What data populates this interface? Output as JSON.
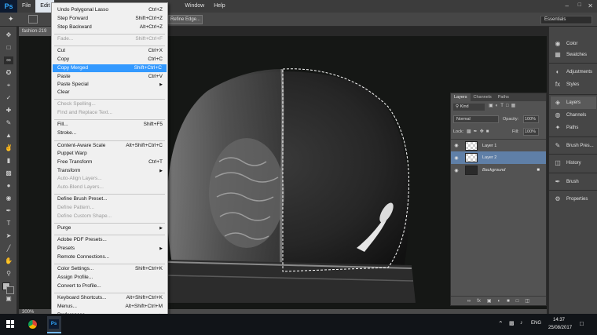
{
  "app": {
    "logo": "Ps"
  },
  "menubar": {
    "items": [
      "File",
      "Edit",
      "Window",
      "Help"
    ]
  },
  "options": {
    "refine_edge": "Refine Edge...",
    "workspace": "Essentials"
  },
  "document": {
    "tab": "fashion-219",
    "zoom": "300%"
  },
  "edit_menu": {
    "items": [
      {
        "label": "Undo Polygonal Lasso",
        "shortcut": "Ctrl+Z",
        "state": "normal"
      },
      {
        "label": "Step Forward",
        "shortcut": "Shift+Ctrl+Z",
        "state": "normal"
      },
      {
        "label": "Step Backward",
        "shortcut": "Alt+Ctrl+Z",
        "state": "normal"
      },
      {
        "label": "Fade...",
        "shortcut": "Shift+Ctrl+F",
        "state": "disabled"
      },
      {
        "label": "Cut",
        "shortcut": "Ctrl+X",
        "state": "normal"
      },
      {
        "label": "Copy",
        "shortcut": "Ctrl+C",
        "state": "normal"
      },
      {
        "label": "Copy Merged",
        "shortcut": "Shift+Ctrl+C",
        "state": "highlight"
      },
      {
        "label": "Paste",
        "shortcut": "Ctrl+V",
        "state": "normal"
      },
      {
        "label": "Paste Special",
        "shortcut": "",
        "state": "submenu"
      },
      {
        "label": "Clear",
        "shortcut": "",
        "state": "normal"
      },
      {
        "label": "Check Spelling...",
        "shortcut": "",
        "state": "disabled"
      },
      {
        "label": "Find and Replace Text...",
        "shortcut": "",
        "state": "disabled"
      },
      {
        "label": "Fill...",
        "shortcut": "Shift+F5",
        "state": "normal"
      },
      {
        "label": "Stroke...",
        "shortcut": "",
        "state": "normal"
      },
      {
        "label": "Content-Aware Scale",
        "shortcut": "Alt+Shift+Ctrl+C",
        "state": "normal"
      },
      {
        "label": "Puppet Warp",
        "shortcut": "",
        "state": "normal"
      },
      {
        "label": "Free Transform",
        "shortcut": "Ctrl+T",
        "state": "normal"
      },
      {
        "label": "Transform",
        "shortcut": "",
        "state": "submenu"
      },
      {
        "label": "Auto-Align Layers...",
        "shortcut": "",
        "state": "disabled"
      },
      {
        "label": "Auto-Blend Layers...",
        "shortcut": "",
        "state": "disabled"
      },
      {
        "label": "Define Brush Preset...",
        "shortcut": "",
        "state": "normal"
      },
      {
        "label": "Define Pattern...",
        "shortcut": "",
        "state": "disabled"
      },
      {
        "label": "Define Custom Shape...",
        "shortcut": "",
        "state": "disabled"
      },
      {
        "label": "Purge",
        "shortcut": "",
        "state": "submenu"
      },
      {
        "label": "Adobe PDF Presets...",
        "shortcut": "",
        "state": "normal"
      },
      {
        "label": "Presets",
        "shortcut": "",
        "state": "submenu"
      },
      {
        "label": "Remote Connections...",
        "shortcut": "",
        "state": "normal"
      },
      {
        "label": "Color Settings...",
        "shortcut": "Shift+Ctrl+K",
        "state": "normal"
      },
      {
        "label": "Assign Profile...",
        "shortcut": "",
        "state": "normal"
      },
      {
        "label": "Convert to Profile...",
        "shortcut": "",
        "state": "normal"
      },
      {
        "label": "Keyboard Shortcuts...",
        "shortcut": "Alt+Shift+Ctrl+K",
        "state": "normal"
      },
      {
        "label": "Menus...",
        "shortcut": "Alt+Shift+Ctrl+M",
        "state": "normal"
      },
      {
        "label": "Preferences",
        "shortcut": "",
        "state": "submenu"
      }
    ]
  },
  "dock": {
    "items": [
      "Color",
      "Swatches",
      "Adjustments",
      "Styles",
      "Layers",
      "Channels",
      "Paths",
      "Brush Pres...",
      "History",
      "Brush",
      "Properties"
    ]
  },
  "layers_panel": {
    "tabs": [
      "Layers",
      "Channels",
      "Paths"
    ],
    "filter": "Kind",
    "blend_mode": "Normal",
    "opacity_label": "Opacity:",
    "opacity": "100%",
    "lock_label": "Lock:",
    "fill_label": "Fill:",
    "fill": "100%",
    "layers": [
      {
        "name": "Layer 1",
        "selected": false
      },
      {
        "name": "Layer 2",
        "selected": true
      },
      {
        "name": "Background",
        "selected": false
      }
    ]
  },
  "taskbar": {
    "lang": "ENG",
    "time": "14:37",
    "date": "25/08/2017"
  }
}
